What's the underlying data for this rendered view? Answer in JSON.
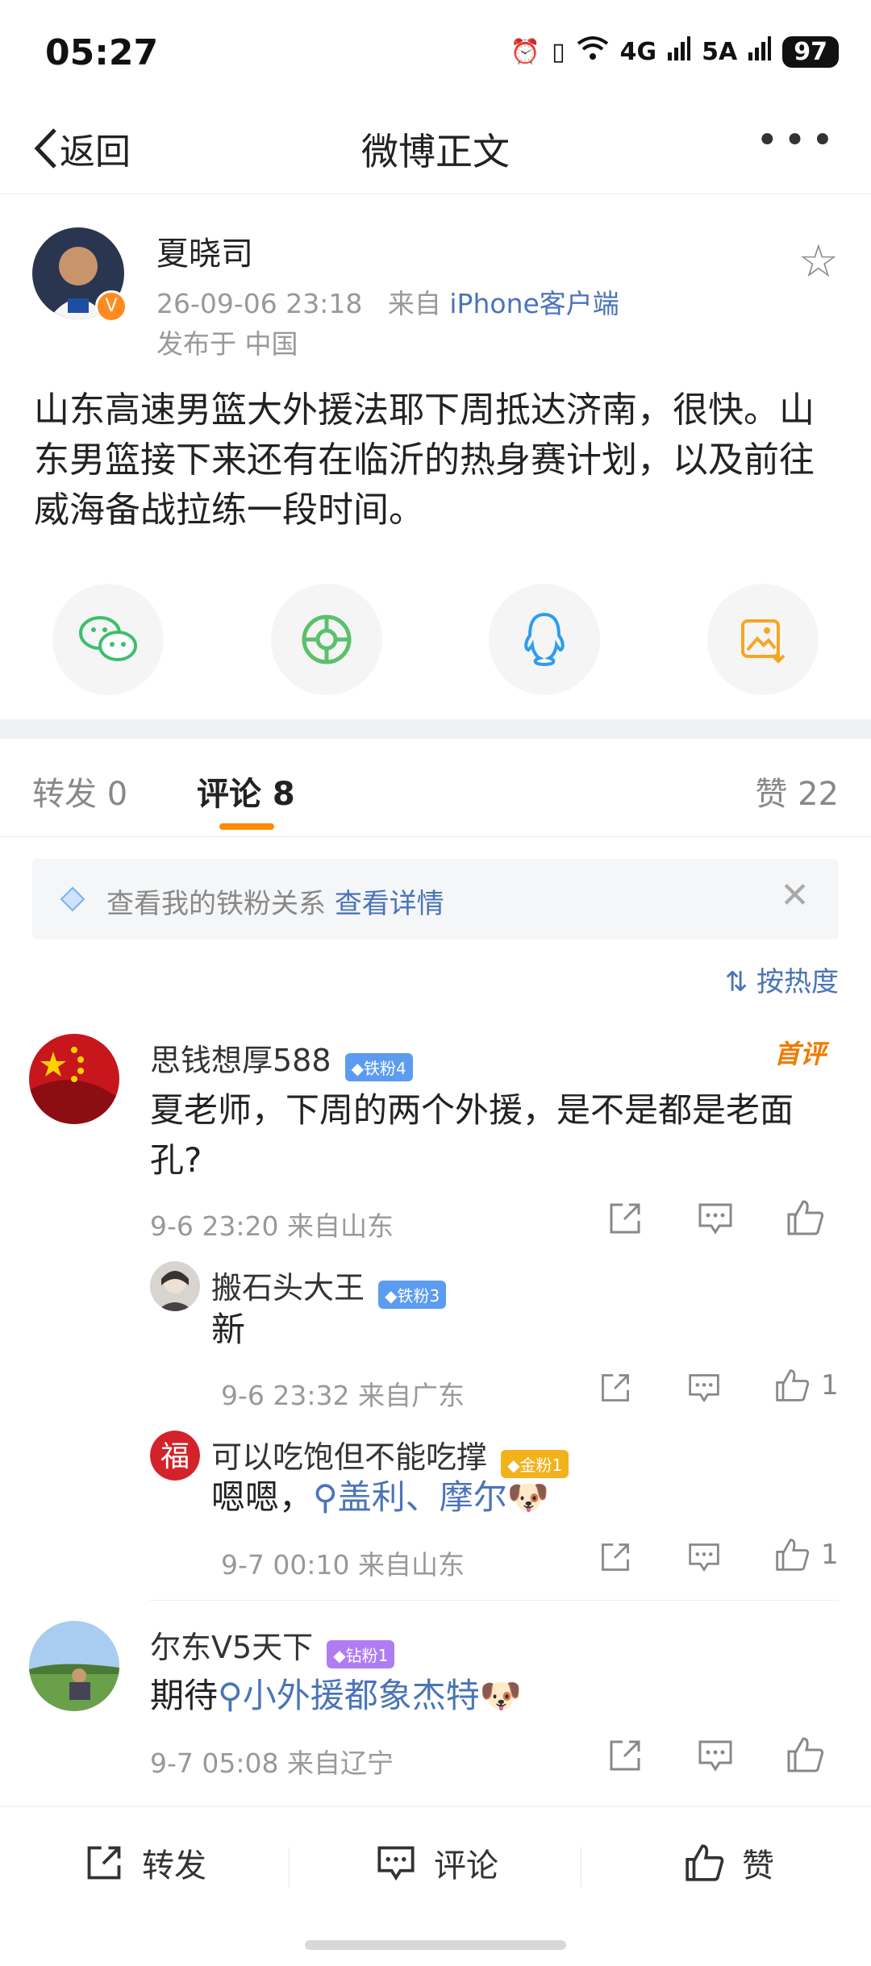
{
  "status_bar": {
    "time": "05:27",
    "network1": "4G",
    "network2": "5A",
    "battery": "97"
  },
  "nav": {
    "back_label": "返回",
    "title": "微博正文"
  },
  "post": {
    "author": "夏晓司",
    "time": "26-09-06 23:18",
    "source_prefix": "来自",
    "source": "iPhone客户端",
    "location": "发布于 中国",
    "content": "山东高速男篮大外援法耶下周抵达济南，很快。山东男篮接下来还有在临沂的热身赛计划，以及前往威海备战拉练一段时间。"
  },
  "share_icons": [
    "wechat-icon",
    "moments-icon",
    "qq-icon",
    "save-image-icon"
  ],
  "tabs": {
    "repost": "转发 0",
    "comment": "评论 8",
    "like": "赞 22"
  },
  "tiefen": {
    "text": "查看我的铁粉关系",
    "link": "查看详情"
  },
  "sort": {
    "label": "按热度"
  },
  "comments": [
    {
      "name": "思钱想厚588",
      "badge": "铁粉4",
      "tag": "首评",
      "text": "夏老师，下周的两个外援，是不是都是老面孔?",
      "meta": "9-6 23:20 来自山东",
      "replies": [
        {
          "name": "搬石头大王",
          "badge": "铁粉3",
          "text": "新",
          "meta": "9-6 23:32 来自广东",
          "likes": "1"
        },
        {
          "name": "可以吃饱但不能吃撑",
          "badge": "金粉1",
          "text_prefix": "嗯嗯，",
          "topic": "盖利、摩尔",
          "meta": "9-7 00:10 来自山东",
          "likes": "1"
        }
      ]
    },
    {
      "name": "尔东V5天下",
      "badge": "钻粉1",
      "text_prefix": "期待",
      "topic": "小外援都象杰特",
      "meta": "9-7 05:08 来自辽宁"
    }
  ],
  "bottom_bar": {
    "repost": "转发",
    "comment": "评论",
    "like": "赞"
  },
  "colors": {
    "accent": "#ff8a00",
    "link": "#4a74b8",
    "wechat": "#3cbf6d",
    "qq": "#2d9cf2",
    "save": "#f5a623"
  }
}
